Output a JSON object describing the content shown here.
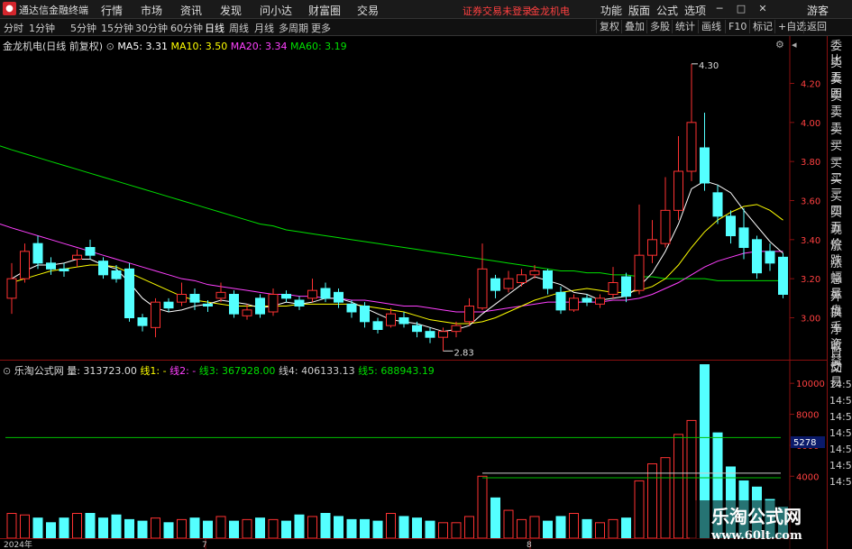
{
  "menubar": {
    "app_title": "通达信金融终端",
    "items": [
      "行情",
      "市场",
      "资讯",
      "发现",
      "问小达",
      "财富圈",
      "交易"
    ],
    "notice": "证券交易未登录",
    "stock": "金龙机电",
    "right_items": [
      "功能",
      "版面",
      "公式",
      "选项"
    ],
    "user": "游客"
  },
  "toolbar": {
    "periods": [
      "分时",
      "1分钟",
      "5分钟",
      "15分钟",
      "30分钟",
      "60分钟",
      "日线",
      "周线",
      "月线",
      "多周期",
      "更多"
    ],
    "active_period": "日线",
    "buttons": [
      "复权",
      "叠加",
      "多股",
      "统计",
      "画线",
      "F10",
      "标记",
      "+自选",
      "返回"
    ]
  },
  "main_legend": {
    "name": "金龙机电(日线 前复权)",
    "ma5": "MA5: 3.31",
    "ma10": "MA10: 3.50",
    "ma20": "MA20: 3.34",
    "ma60": "MA60: 3.19"
  },
  "vol_legend": {
    "name": "乐淘公式网",
    "vol": "量: 313723.00",
    "l1": "线1: -",
    "l2": "线2: -",
    "l3": "线3: 367928.00",
    "l4": "线4: 406133.13",
    "l5": "线5: 688943.19"
  },
  "annotations": {
    "high": "4.30",
    "low": "2.83"
  },
  "right_panel": {
    "items": [
      "委比",
      "卖五",
      "卖四",
      "卖三",
      "卖二",
      "卖一",
      "买一",
      "买二",
      "买三",
      "买四",
      "买五",
      "现价",
      "涨跌",
      "涨幅",
      "总量",
      "外盘",
      "换手",
      "净资",
      "收益"
    ],
    "lower_items": [
      "自动",
      "交易"
    ],
    "times": [
      "14:56",
      "14:56",
      "14:56",
      "14:56",
      "14:56",
      "14:56",
      "14:56"
    ]
  },
  "vol_axis_highlight": "5278",
  "date_labels": [
    "2024年",
    "7",
    "8"
  ],
  "watermark": {
    "title": "乐淘公式网",
    "url": "www.60lt.com"
  },
  "colors": {
    "up": "#ff3232",
    "down": "#54ffff",
    "ma5": "#ffffff",
    "ma10": "#ffff00",
    "ma20": "#ff40ff",
    "ma60": "#00e000",
    "grid_border": "#8a1010"
  },
  "chart_data": [
    {
      "type": "candlestick",
      "title": "金龙机电(日线 前复权)",
      "ylim": [
        2.85,
        4.35
      ],
      "yticks": [
        3.0,
        3.2,
        3.4,
        3.6,
        3.8,
        4.0,
        4.2
      ],
      "candles": [
        {
          "o": 3.1,
          "c": 3.2,
          "h": 3.28,
          "l": 3.02
        },
        {
          "o": 3.2,
          "c": 3.34,
          "h": 3.38,
          "l": 3.18
        },
        {
          "o": 3.38,
          "c": 3.28,
          "h": 3.42,
          "l": 3.25
        },
        {
          "o": 3.28,
          "c": 3.25,
          "h": 3.31,
          "l": 3.22
        },
        {
          "o": 3.25,
          "c": 3.24,
          "h": 3.28,
          "l": 3.21
        },
        {
          "o": 3.3,
          "c": 3.32,
          "h": 3.35,
          "l": 3.26
        },
        {
          "o": 3.36,
          "c": 3.32,
          "h": 3.4,
          "l": 3.3
        },
        {
          "o": 3.29,
          "c": 3.22,
          "h": 3.31,
          "l": 3.2
        },
        {
          "o": 3.24,
          "c": 3.2,
          "h": 3.27,
          "l": 3.18
        },
        {
          "o": 3.25,
          "c": 3.0,
          "h": 3.28,
          "l": 2.98
        },
        {
          "o": 3.0,
          "c": 2.96,
          "h": 3.02,
          "l": 2.93
        },
        {
          "o": 2.95,
          "c": 3.08,
          "h": 3.1,
          "l": 2.9
        },
        {
          "o": 3.08,
          "c": 3.05,
          "h": 3.1,
          "l": 3.03
        },
        {
          "o": 3.08,
          "c": 3.12,
          "h": 3.18,
          "l": 3.06
        },
        {
          "o": 3.12,
          "c": 3.08,
          "h": 3.15,
          "l": 3.04
        },
        {
          "o": 3.07,
          "c": 3.06,
          "h": 3.09,
          "l": 3.03
        },
        {
          "o": 3.1,
          "c": 3.13,
          "h": 3.18,
          "l": 3.08
        },
        {
          "o": 3.12,
          "c": 3.02,
          "h": 3.14,
          "l": 3.0
        },
        {
          "o": 3.01,
          "c": 3.04,
          "h": 3.07,
          "l": 2.99
        },
        {
          "o": 3.1,
          "c": 3.02,
          "h": 3.12,
          "l": 3.0
        },
        {
          "o": 3.03,
          "c": 3.12,
          "h": 3.15,
          "l": 3.01
        },
        {
          "o": 3.12,
          "c": 3.1,
          "h": 3.14,
          "l": 3.08
        },
        {
          "o": 3.09,
          "c": 3.06,
          "h": 3.11,
          "l": 3.04
        },
        {
          "o": 3.1,
          "c": 3.14,
          "h": 3.2,
          "l": 3.08
        },
        {
          "o": 3.15,
          "c": 3.1,
          "h": 3.18,
          "l": 3.08
        },
        {
          "o": 3.13,
          "c": 3.08,
          "h": 3.15,
          "l": 3.05
        },
        {
          "o": 3.07,
          "c": 3.03,
          "h": 3.09,
          "l": 3.0
        },
        {
          "o": 3.06,
          "c": 2.98,
          "h": 3.08,
          "l": 2.95
        },
        {
          "o": 2.98,
          "c": 2.94,
          "h": 3.0,
          "l": 2.92
        },
        {
          "o": 2.96,
          "c": 3.02,
          "h": 3.05,
          "l": 2.95
        },
        {
          "o": 3.0,
          "c": 2.97,
          "h": 3.03,
          "l": 2.95
        },
        {
          "o": 2.96,
          "c": 2.93,
          "h": 2.98,
          "l": 2.9
        },
        {
          "o": 2.93,
          "c": 2.9,
          "h": 2.95,
          "l": 2.87
        },
        {
          "o": 2.9,
          "c": 2.93,
          "h": 2.95,
          "l": 2.83
        },
        {
          "o": 2.93,
          "c": 2.96,
          "h": 2.98,
          "l": 2.9
        },
        {
          "o": 2.98,
          "c": 3.06,
          "h": 3.1,
          "l": 2.96
        },
        {
          "o": 3.05,
          "c": 3.25,
          "h": 3.38,
          "l": 3.04
        },
        {
          "o": 3.2,
          "c": 3.14,
          "h": 3.22,
          "l": 3.1
        },
        {
          "o": 3.15,
          "c": 3.2,
          "h": 3.24,
          "l": 3.13
        },
        {
          "o": 3.18,
          "c": 3.22,
          "h": 3.25,
          "l": 3.16
        },
        {
          "o": 3.22,
          "c": 3.24,
          "h": 3.27,
          "l": 3.2
        },
        {
          "o": 3.24,
          "c": 3.15,
          "h": 3.25,
          "l": 3.12
        },
        {
          "o": 3.13,
          "c": 3.04,
          "h": 3.16,
          "l": 3.02
        },
        {
          "o": 3.04,
          "c": 3.1,
          "h": 3.12,
          "l": 3.03
        },
        {
          "o": 3.1,
          "c": 3.08,
          "h": 3.12,
          "l": 3.06
        },
        {
          "o": 3.07,
          "c": 3.1,
          "h": 3.12,
          "l": 3.05
        },
        {
          "o": 3.12,
          "c": 3.18,
          "h": 3.26,
          "l": 3.1
        },
        {
          "o": 3.21,
          "c": 3.11,
          "h": 3.23,
          "l": 3.08
        },
        {
          "o": 3.14,
          "c": 3.32,
          "h": 3.58,
          "l": 3.12
        },
        {
          "o": 3.32,
          "c": 3.4,
          "h": 3.5,
          "l": 3.28
        },
        {
          "o": 3.38,
          "c": 3.55,
          "h": 3.72,
          "l": 3.36
        },
        {
          "o": 3.55,
          "c": 3.75,
          "h": 3.93,
          "l": 3.5
        },
        {
          "o": 3.75,
          "c": 4.0,
          "h": 4.3,
          "l": 3.7
        },
        {
          "o": 3.87,
          "c": 3.69,
          "h": 4.05,
          "l": 3.65
        },
        {
          "o": 3.64,
          "c": 3.52,
          "h": 3.68,
          "l": 3.48
        },
        {
          "o": 3.52,
          "c": 3.42,
          "h": 3.55,
          "l": 3.38
        },
        {
          "o": 3.46,
          "c": 3.36,
          "h": 3.56,
          "l": 3.3
        },
        {
          "o": 3.4,
          "c": 3.23,
          "h": 3.42,
          "l": 3.2
        },
        {
          "o": 3.34,
          "c": 3.28,
          "h": 3.38,
          "l": 3.24
        },
        {
          "o": 3.31,
          "c": 3.12,
          "h": 3.33,
          "l": 3.1
        }
      ],
      "ma5": [
        3.2,
        3.24,
        3.27,
        3.27,
        3.28,
        3.3,
        3.3,
        3.27,
        3.25,
        3.18,
        3.1,
        3.05,
        3.03,
        3.04,
        3.06,
        3.07,
        3.09,
        3.08,
        3.07,
        3.05,
        3.06,
        3.08,
        3.07,
        3.08,
        3.1,
        3.1,
        3.08,
        3.05,
        3.02,
        2.99,
        2.98,
        2.97,
        2.95,
        2.93,
        2.94,
        2.96,
        3.02,
        3.07,
        3.12,
        3.17,
        3.21,
        3.19,
        3.17,
        3.13,
        3.12,
        3.09,
        3.1,
        3.11,
        3.16,
        3.23,
        3.34,
        3.48,
        3.66,
        3.7,
        3.68,
        3.64,
        3.55,
        3.47,
        3.39,
        3.33
      ],
      "ma10": [
        3.18,
        3.2,
        3.22,
        3.24,
        3.25,
        3.26,
        3.27,
        3.27,
        3.26,
        3.23,
        3.2,
        3.17,
        3.14,
        3.11,
        3.09,
        3.08,
        3.07,
        3.06,
        3.06,
        3.06,
        3.06,
        3.06,
        3.07,
        3.07,
        3.07,
        3.07,
        3.07,
        3.06,
        3.05,
        3.04,
        3.03,
        3.01,
        2.99,
        2.98,
        2.97,
        2.97,
        2.98,
        3.0,
        3.03,
        3.06,
        3.09,
        3.11,
        3.13,
        3.14,
        3.15,
        3.14,
        3.13,
        3.13,
        3.14,
        3.16,
        3.2,
        3.27,
        3.36,
        3.44,
        3.5,
        3.54,
        3.57,
        3.58,
        3.55,
        3.5
      ],
      "ma20": [
        3.46,
        3.44,
        3.42,
        3.4,
        3.38,
        3.36,
        3.34,
        3.32,
        3.3,
        3.28,
        3.26,
        3.24,
        3.22,
        3.2,
        3.19,
        3.17,
        3.16,
        3.15,
        3.14,
        3.13,
        3.12,
        3.12,
        3.11,
        3.11,
        3.1,
        3.1,
        3.09,
        3.09,
        3.08,
        3.07,
        3.06,
        3.06,
        3.05,
        3.04,
        3.03,
        3.03,
        3.03,
        3.04,
        3.05,
        3.06,
        3.07,
        3.08,
        3.08,
        3.08,
        3.08,
        3.08,
        3.09,
        3.09,
        3.1,
        3.12,
        3.15,
        3.18,
        3.22,
        3.26,
        3.29,
        3.31,
        3.33,
        3.34,
        3.34,
        3.34
      ],
      "ma60": [
        3.86,
        3.84,
        3.82,
        3.8,
        3.78,
        3.76,
        3.74,
        3.72,
        3.7,
        3.68,
        3.66,
        3.64,
        3.62,
        3.6,
        3.58,
        3.56,
        3.54,
        3.52,
        3.5,
        3.48,
        3.47,
        3.45,
        3.44,
        3.43,
        3.42,
        3.41,
        3.4,
        3.39,
        3.38,
        3.37,
        3.36,
        3.35,
        3.34,
        3.33,
        3.32,
        3.31,
        3.3,
        3.29,
        3.28,
        3.27,
        3.26,
        3.25,
        3.24,
        3.24,
        3.23,
        3.23,
        3.22,
        3.22,
        3.21,
        3.21,
        3.2,
        3.2,
        3.2,
        3.2,
        3.19,
        3.19,
        3.19,
        3.19,
        3.19,
        3.19
      ]
    },
    {
      "type": "bar",
      "title": "乐淘公式网",
      "ylim": [
        0,
        11000
      ],
      "yticks": [
        4000,
        6000,
        8000,
        10000
      ],
      "volumes": [
        1600,
        1500,
        1300,
        1000,
        1300,
        1600,
        1600,
        1300,
        1500,
        1200,
        1100,
        1300,
        1000,
        1200,
        1300,
        1100,
        1400,
        1100,
        1200,
        1300,
        1200,
        1100,
        1500,
        1400,
        1600,
        1400,
        1200,
        1200,
        1100,
        1600,
        1400,
        1300,
        1100,
        1000,
        1000,
        1400,
        4000,
        2600,
        1800,
        1200,
        1400,
        1100,
        1400,
        1600,
        1200,
        1000,
        1200,
        1300,
        3700,
        4800,
        5200,
        6700,
        7600,
        11200,
        6800,
        4600,
        3700,
        3300,
        2500,
        2000
      ],
      "hlines": [
        6500,
        4200,
        3900
      ]
    }
  ]
}
